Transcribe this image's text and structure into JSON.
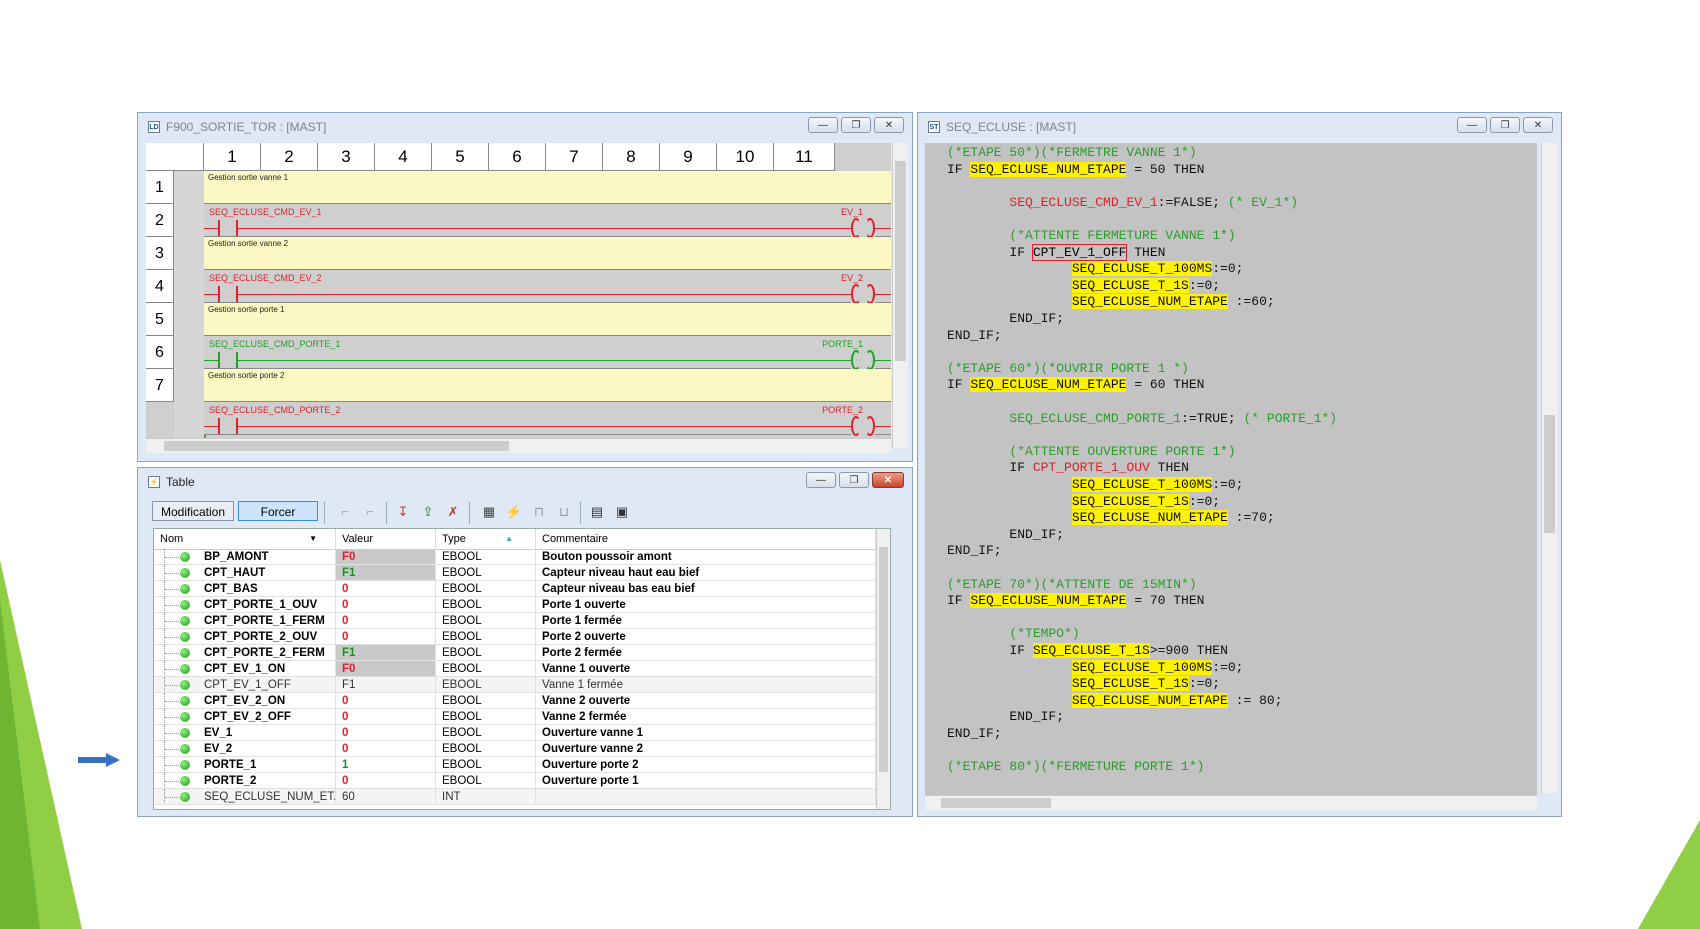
{
  "ladder_window": {
    "title": "F900_SORTIE_TOR : [MAST]",
    "icon": "ladder-section-icon",
    "columns": [
      "1",
      "2",
      "3",
      "4",
      "5",
      "6",
      "7",
      "8",
      "9",
      "10",
      "11"
    ],
    "rows": [
      "1",
      "2",
      "3",
      "4",
      "5",
      "6",
      "7"
    ],
    "rungs": [
      {
        "kind": "comment",
        "text": "Gestion sortie vanne 1"
      },
      {
        "kind": "rung",
        "input": "SEQ_ECLUSE_CMD_EV_1",
        "output": "EV_1",
        "state": "off"
      },
      {
        "kind": "comment",
        "text": "Gestion sortie vanne 2"
      },
      {
        "kind": "rung",
        "input": "SEQ_ECLUSE_CMD_EV_2",
        "output": "EV_2",
        "state": "off"
      },
      {
        "kind": "comment",
        "text": "Gestion sortie porte 1"
      },
      {
        "kind": "rung",
        "input": "SEQ_ECLUSE_CMD_PORTE_1",
        "output": "PORTE_1",
        "state": "on"
      },
      {
        "kind": "comment",
        "text": "Gestion sortie porte 2"
      },
      {
        "kind": "rung",
        "input": "SEQ_ECLUSE_CMD_PORTE_2",
        "output": "PORTE_2",
        "state": "off"
      }
    ]
  },
  "table_window": {
    "title": "Table",
    "buttons": {
      "modification": "Modification",
      "forcer": "Forcer"
    },
    "headers": {
      "nom": "Nom",
      "valeur": "Valeur",
      "type": "Type",
      "commentaire": "Commentaire"
    },
    "rows": [
      {
        "nom": "BP_AMONT",
        "valeur": "F0",
        "type": "EBOOL",
        "commentaire": "Bouton poussoir amont",
        "color": "red",
        "forced": true,
        "dim": false
      },
      {
        "nom": "CPT_HAUT",
        "valeur": "F1",
        "type": "EBOOL",
        "commentaire": "Capteur niveau haut eau bief",
        "color": "green",
        "forced": true,
        "dim": false
      },
      {
        "nom": "CPT_BAS",
        "valeur": "0",
        "type": "EBOOL",
        "commentaire": "Capteur niveau bas eau bief",
        "color": "red",
        "forced": false,
        "dim": false
      },
      {
        "nom": "CPT_PORTE_1_OUV",
        "valeur": "0",
        "type": "EBOOL",
        "commentaire": "Porte 1 ouverte",
        "color": "red",
        "forced": false,
        "dim": false
      },
      {
        "nom": "CPT_PORTE_1_FERM",
        "valeur": "0",
        "type": "EBOOL",
        "commentaire": "Porte 1 fermée",
        "color": "red",
        "forced": false,
        "dim": false
      },
      {
        "nom": "CPT_PORTE_2_OUV",
        "valeur": "0",
        "type": "EBOOL",
        "commentaire": "Porte 2 ouverte",
        "color": "red",
        "forced": false,
        "dim": false
      },
      {
        "nom": "CPT_PORTE_2_FERM",
        "valeur": "F1",
        "type": "EBOOL",
        "commentaire": "Porte 2 fermée",
        "color": "green",
        "forced": true,
        "dim": false
      },
      {
        "nom": "CPT_EV_1_ON",
        "valeur": "F0",
        "type": "EBOOL",
        "commentaire": "Vanne 1 ouverte",
        "color": "red",
        "forced": true,
        "dim": false
      },
      {
        "nom": "CPT_EV_1_OFF",
        "valeur": "F1",
        "type": "EBOOL",
        "commentaire": "Vanne 1 fermée",
        "color": "plain",
        "forced": false,
        "dim": true
      },
      {
        "nom": "CPT_EV_2_ON",
        "valeur": "0",
        "type": "EBOOL",
        "commentaire": "Vanne 2 ouverte",
        "color": "red",
        "forced": false,
        "dim": false
      },
      {
        "nom": "CPT_EV_2_OFF",
        "valeur": "0",
        "type": "EBOOL",
        "commentaire": "Vanne 2 fermée",
        "color": "red",
        "forced": false,
        "dim": false
      },
      {
        "nom": "EV_1",
        "valeur": "0",
        "type": "EBOOL",
        "commentaire": "Ouverture vanne 1",
        "color": "red",
        "forced": false,
        "dim": false
      },
      {
        "nom": "EV_2",
        "valeur": "0",
        "type": "EBOOL",
        "commentaire": "Ouverture vanne 2",
        "color": "red",
        "forced": false,
        "dim": false
      },
      {
        "nom": "PORTE_1",
        "valeur": "1",
        "type": "EBOOL",
        "commentaire": "Ouverture porte 2",
        "color": "green",
        "forced": false,
        "dim": false
      },
      {
        "nom": "PORTE_2",
        "valeur": "0",
        "type": "EBOOL",
        "commentaire": "Ouverture porte 1",
        "color": "red",
        "forced": false,
        "dim": false
      },
      {
        "nom": "SEQ_ECLUSE_NUM_ET...",
        "valeur": "60",
        "type": "INT",
        "commentaire": "",
        "color": "plain",
        "forced": false,
        "dim": true
      }
    ]
  },
  "code_window": {
    "title": "SEQ_ECLUSE : [MAST]",
    "icon": "st-section-icon",
    "lines": [
      [
        {
          "t": "(*ETAPE 50*)(*FERMETRE VANNE 1*)",
          "c": "cm"
        }
      ],
      [
        {
          "t": "IF ",
          "c": "kw"
        },
        {
          "t": "SEQ_ECLUSE_NUM_ETAPE",
          "c": "hl"
        },
        {
          "t": " = 50 THEN",
          "c": "kw"
        }
      ],
      [],
      [
        {
          "t": "        ",
          "c": "kw"
        },
        {
          "t": "SEQ_ECLUSE_CMD_EV_1",
          "c": "rv"
        },
        {
          "t": ":=FALSE; ",
          "c": "kw"
        },
        {
          "t": "(* EV_1*)",
          "c": "cm"
        }
      ],
      [],
      [
        {
          "t": "        (*ATTENTE FERMETURE VANNE 1*)",
          "c": "cm"
        }
      ],
      [
        {
          "t": "        IF ",
          "c": "kw"
        },
        {
          "t": "CPT_EV_1_OFF",
          "c": "box"
        },
        {
          "t": " THEN",
          "c": "kw"
        }
      ],
      [
        {
          "t": "                ",
          "c": "kw"
        },
        {
          "t": "SEQ_ECLUSE_T_100MS",
          "c": "hl"
        },
        {
          "t": ":=0;",
          "c": "kw"
        }
      ],
      [
        {
          "t": "                ",
          "c": "kw"
        },
        {
          "t": "SEQ_ECLUSE_T_1S",
          "c": "hl"
        },
        {
          "t": ":=0;",
          "c": "kw"
        }
      ],
      [
        {
          "t": "                ",
          "c": "kw"
        },
        {
          "t": "SEQ_ECLUSE_NUM_ETAPE",
          "c": "hl"
        },
        {
          "t": " :=60;",
          "c": "kw"
        }
      ],
      [
        {
          "t": "        END_IF;",
          "c": "kw"
        }
      ],
      [
        {
          "t": "END_IF;",
          "c": "kw"
        }
      ],
      [],
      [
        {
          "t": "(*ETAPE 60*)(*OUVRIR PORTE 1 *)",
          "c": "cm"
        }
      ],
      [
        {
          "t": "IF ",
          "c": "kw"
        },
        {
          "t": "SEQ_ECLUSE_NUM_ETAPE",
          "c": "hl"
        },
        {
          "t": " = 60 THEN",
          "c": "kw"
        }
      ],
      [],
      [
        {
          "t": "        ",
          "c": "kw"
        },
        {
          "t": "SEQ_ECLUSE_CMD_PORTE_1",
          "c": "cm"
        },
        {
          "t": ":=TRUE; ",
          "c": "kw"
        },
        {
          "t": "(* PORTE_1*)",
          "c": "cm"
        }
      ],
      [],
      [
        {
          "t": "        (*ATTENTE OUVERTURE PORTE 1*)",
          "c": "cm"
        }
      ],
      [
        {
          "t": "        IF ",
          "c": "kw"
        },
        {
          "t": "CPT_PORTE_1_OUV",
          "c": "rv"
        },
        {
          "t": " THEN",
          "c": "kw"
        }
      ],
      [
        {
          "t": "                ",
          "c": "kw"
        },
        {
          "t": "SEQ_ECLUSE_T_100MS",
          "c": "hl"
        },
        {
          "t": ":=0;",
          "c": "kw"
        }
      ],
      [
        {
          "t": "                ",
          "c": "kw"
        },
        {
          "t": "SEQ_ECLUSE_T_1S",
          "c": "hl"
        },
        {
          "t": ":=0;",
          "c": "kw"
        }
      ],
      [
        {
          "t": "                ",
          "c": "kw"
        },
        {
          "t": "SEQ_ECLUSE_NUM_ETAPE",
          "c": "hl"
        },
        {
          "t": " :=70;",
          "c": "kw"
        }
      ],
      [
        {
          "t": "        END_IF;",
          "c": "kw"
        }
      ],
      [
        {
          "t": "END_IF;",
          "c": "kw"
        }
      ],
      [],
      [
        {
          "t": "(*ETAPE 70*)(*ATTENTE DE 15MIN*)",
          "c": "cm"
        }
      ],
      [
        {
          "t": "IF ",
          "c": "kw"
        },
        {
          "t": "SEQ_ECLUSE_NUM_ETAPE",
          "c": "hl"
        },
        {
          "t": " = 70 THEN",
          "c": "kw"
        }
      ],
      [],
      [
        {
          "t": "        (*TEMPO*)",
          "c": "cm"
        }
      ],
      [
        {
          "t": "        IF ",
          "c": "kw"
        },
        {
          "t": "SEQ_ECLUSE_T_1S",
          "c": "hl"
        },
        {
          "t": ">=900 THEN",
          "c": "kw"
        }
      ],
      [
        {
          "t": "                ",
          "c": "kw"
        },
        {
          "t": "SEQ_ECLUSE_T_100MS",
          "c": "hl"
        },
        {
          "t": ":=0;",
          "c": "kw"
        }
      ],
      [
        {
          "t": "                ",
          "c": "kw"
        },
        {
          "t": "SEQ_ECLUSE_T_1S",
          "c": "hl"
        },
        {
          "t": ":=0;",
          "c": "kw"
        }
      ],
      [
        {
          "t": "                ",
          "c": "kw"
        },
        {
          "t": "SEQ_ECLUSE_NUM_ETAPE",
          "c": "hl"
        },
        {
          "t": " := 80;",
          "c": "kw"
        }
      ],
      [
        {
          "t": "        END_IF;",
          "c": "kw"
        }
      ],
      [
        {
          "t": "END_IF;",
          "c": "kw"
        }
      ],
      [],
      [
        {
          "t": "(*ETAPE 80*)(*FERMETURE PORTE 1*)",
          "c": "cm"
        }
      ]
    ]
  },
  "colors": {
    "accent_green": "#8fce45",
    "highlight": "#fff200",
    "false_red": "#e0202a",
    "true_green": "#1fa22a"
  }
}
